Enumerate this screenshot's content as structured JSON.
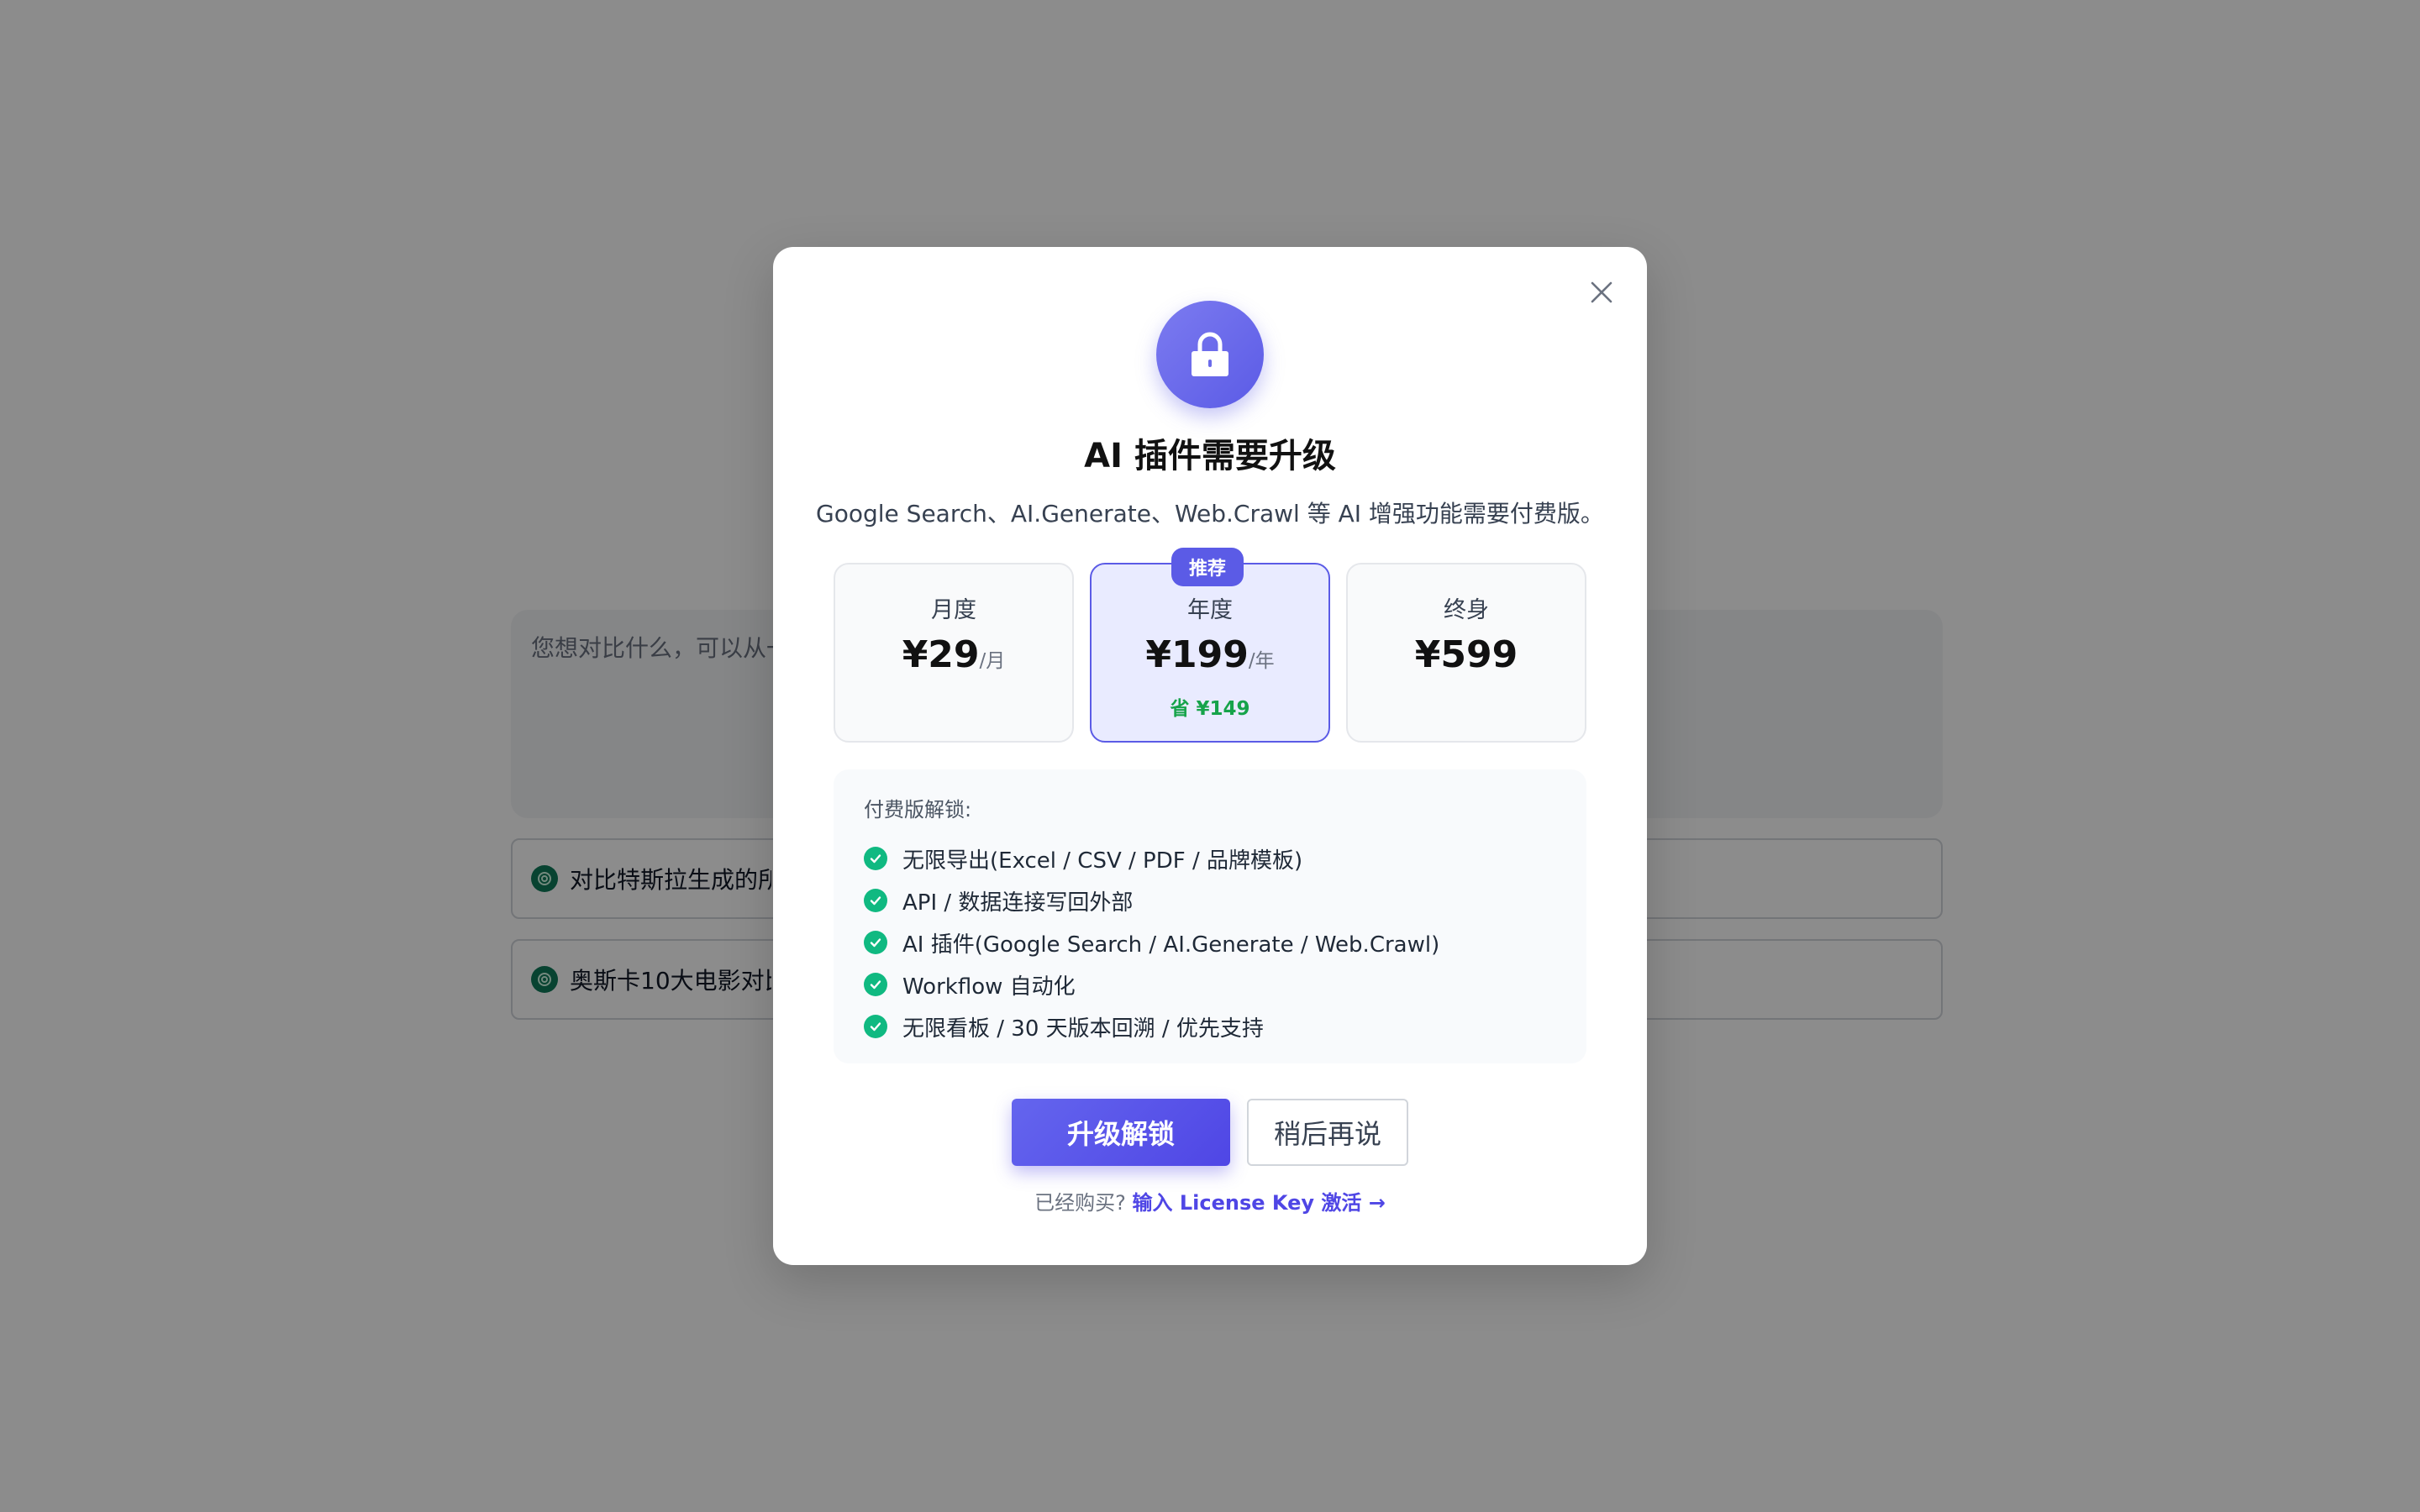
{
  "background": {
    "textarea_placeholder": "您想对比什么，可以从一",
    "items": [
      {
        "label": "对比特斯拉生成的所"
      },
      {
        "label": "奥斯卡10大电影对比"
      }
    ]
  },
  "modal": {
    "title": "AI 插件需要升级",
    "subtitle": "Google Search、AI.Generate、Web.Crawl 等 AI 增强功能需要付费版。",
    "plans": [
      {
        "name": "月度",
        "price": "¥29",
        "unit": "/月"
      },
      {
        "name": "年度",
        "price": "¥199",
        "unit": "/年",
        "badge": "推荐",
        "save": "省 ¥149"
      },
      {
        "name": "终身",
        "price": "¥599"
      }
    ],
    "features_title": "付费版解锁:",
    "features": [
      "无限导出(Excel / CSV / PDF / 品牌模板)",
      "API / 数据连接写回外部",
      "AI 插件(Google Search / AI.Generate / Web.Crawl)",
      "Workflow 自动化",
      "无限看板 / 30 天版本回溯 / 优先支持"
    ],
    "upgrade_label": "升级解锁",
    "later_label": "稍后再说",
    "footer_text": "已经购买? ",
    "footer_link": "输入 License Key 激活 →"
  },
  "colors": {
    "accent": "#5b5be6",
    "success": "#10b981",
    "save_text": "#16a34a"
  },
  "icons": [
    "lock-icon",
    "close-icon",
    "check-icon",
    "openai-icon"
  ]
}
